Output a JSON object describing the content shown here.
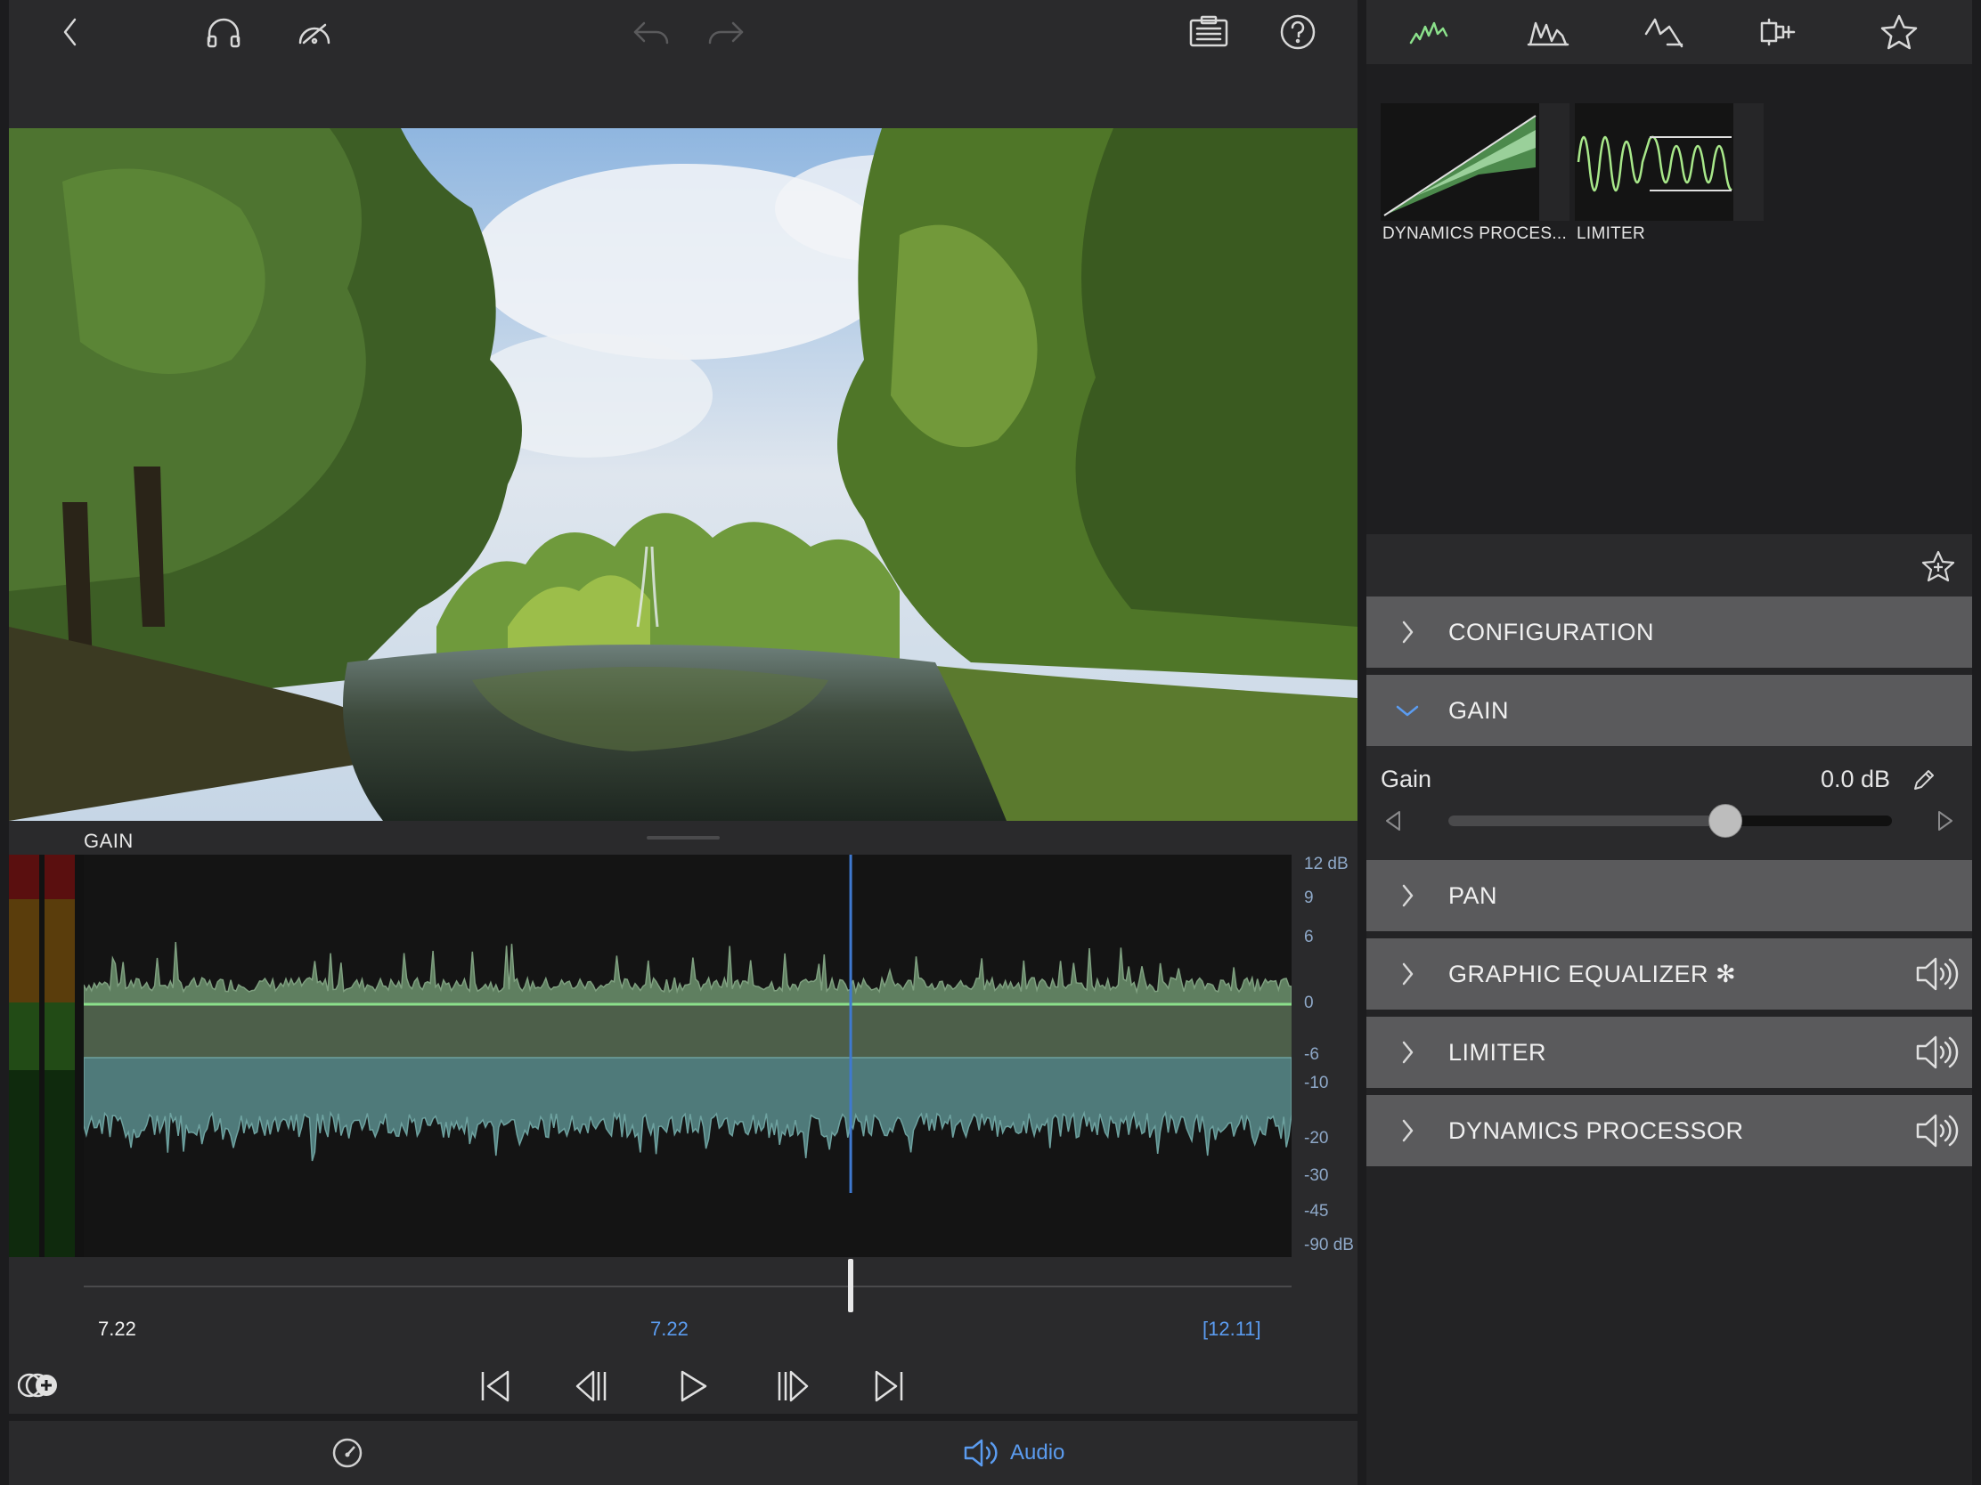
{
  "toolbar": {
    "left_icons": [
      "back-chevron-icon",
      "headphones-icon",
      "speedometer-icon"
    ],
    "center_icons": [
      "undo-icon",
      "redo-icon"
    ],
    "right_icons": [
      "clipboard-icon",
      "help-icon"
    ]
  },
  "editor": {
    "title": "GAIN",
    "db_scale": [
      "12 dB",
      "9",
      "6",
      "0",
      "-6",
      "-10",
      "-20",
      "-30",
      "-45",
      "-90 dB"
    ],
    "time_start": "7.22",
    "time_current": "7.22",
    "time_duration": "[12.11]",
    "playhead_fraction": 0.635,
    "scrub_fraction": 0.635
  },
  "transport": {
    "icons": [
      "skip-to-start-icon",
      "step-back-icon",
      "play-icon",
      "step-forward-icon",
      "skip-to-end-icon"
    ]
  },
  "tabbar": {
    "audio_label": "Audio"
  },
  "effects": {
    "tabs": [
      "dynamics-tab-icon",
      "equalizer-tab-icon",
      "filter-tab-icon",
      "amplifier-tab-icon",
      "favorites-tab-icon"
    ],
    "plugins": [
      {
        "label": "DYNAMICS PROCES..."
      },
      {
        "label": "LIMITER"
      }
    ]
  },
  "sections": {
    "configuration": "CONFIGURATION",
    "gain": "GAIN",
    "pan": "PAN",
    "graphic_eq": "GRAPHIC EQUALIZER ✻",
    "limiter": "LIMITER",
    "dynamics": "DYNAMICS PROCESSOR"
  },
  "gain_control": {
    "label": "Gain",
    "value": "0.0 dB",
    "slider_fraction": 0.625
  },
  "colors": {
    "accent_blue": "#5b9cf0",
    "wave_green": "#8be08b",
    "section_bg": "#5a5a5c"
  }
}
